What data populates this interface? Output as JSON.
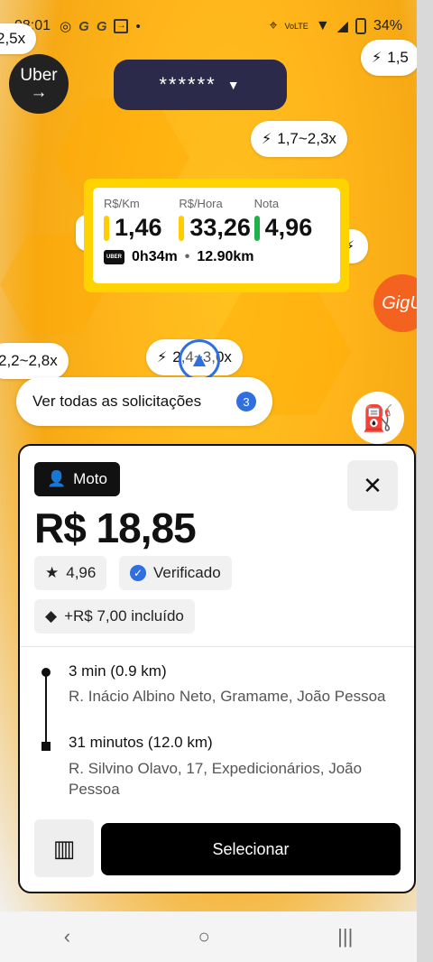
{
  "status_bar": {
    "time": "08:01",
    "icons": [
      "wifi-icon",
      "g-icon",
      "g-icon",
      "box-icon",
      "dot-icon"
    ],
    "network": "VoLTE",
    "battery": "34%"
  },
  "map": {
    "uber_logo": "Uber",
    "masked_text": "******",
    "surge_pills": [
      "2,5x",
      "1,5",
      "1,7~2,3x",
      "2,2~2,8x",
      "2,4~3,0x"
    ],
    "gigu_label": "GigU",
    "requests_label": "Ver todas as solicitações",
    "requests_count": "3"
  },
  "stats": {
    "labels": [
      "R$/Km",
      "R$/Hora",
      "Nota"
    ],
    "values": [
      "1,46",
      "33,26",
      "4,96"
    ],
    "uber_mini": "UBER",
    "duration": "0h34m",
    "distance": "12.90km"
  },
  "ride": {
    "type": "Moto",
    "price": "R$ 18,85",
    "rating": "4,96",
    "verified": "Verificado",
    "bonus": "+R$ 7,00 incluído",
    "pickup_time": "3 min (0.9 km)",
    "pickup_address": "R. Inácio Albino Neto, Gramame, João Pessoa",
    "dropoff_time": "31 minutos (12.0 km)",
    "dropoff_address": "R. Silvino Olavo, 17, Expedicionários, João Pessoa",
    "select_label": "Selecionar"
  },
  "colors": {
    "accent_yellow": "#ffd300",
    "accent_blue": "#2f6fe0",
    "gigu_orange": "#f4621f"
  }
}
